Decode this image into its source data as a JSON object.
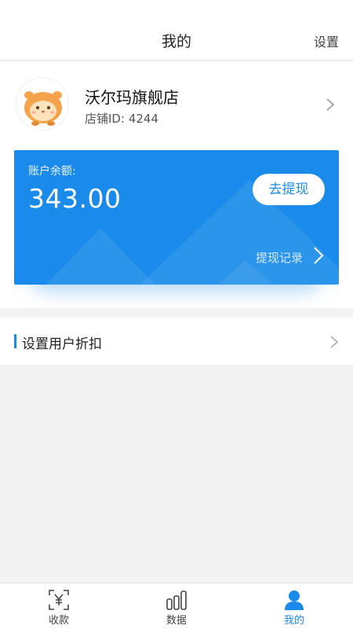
{
  "header": {
    "title": "我的",
    "settings_label": "设置"
  },
  "profile": {
    "store_name": "沃尔玛旗舰店",
    "store_id_label": "店铺ID:",
    "store_id": "4244",
    "avatar_icon": "hamster-avatar-icon"
  },
  "balance": {
    "label": "账户余额:",
    "amount": "343.00",
    "withdraw_label": "去提现",
    "history_label": "提现记录"
  },
  "discount": {
    "label": "设置用户折扣"
  },
  "bottom_nav": {
    "items": [
      {
        "label": "收款",
        "icon": "yuan-scan-icon",
        "active": false
      },
      {
        "label": "数据",
        "icon": "bar-chart-icon",
        "active": false
      },
      {
        "label": "我的",
        "icon": "user-icon",
        "active": true
      }
    ]
  },
  "colors": {
    "accent": "#1a8bea",
    "page_bg": "#f3f3f3",
    "avatar_orange": "#f5a34a"
  }
}
